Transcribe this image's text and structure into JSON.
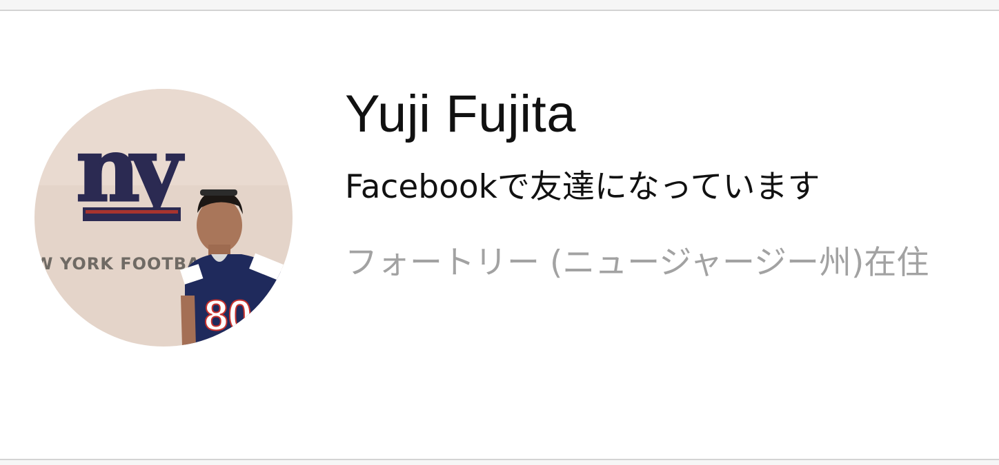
{
  "profile": {
    "name": "Yuji Fujita",
    "subtitle": "Facebookで友達になっています",
    "location": "フォートリー (ニュージャージー州)在住",
    "photo_wall_text": "ny",
    "photo_wall_caption": "W YORK FOOTBALL",
    "jersey_number": "80"
  },
  "colors": {
    "name_text": "#111111",
    "location_text": "#a2a2a2",
    "divider": "#d3d3d3",
    "giants_blue": "#1f2a5c",
    "giants_red": "#c8322e"
  }
}
